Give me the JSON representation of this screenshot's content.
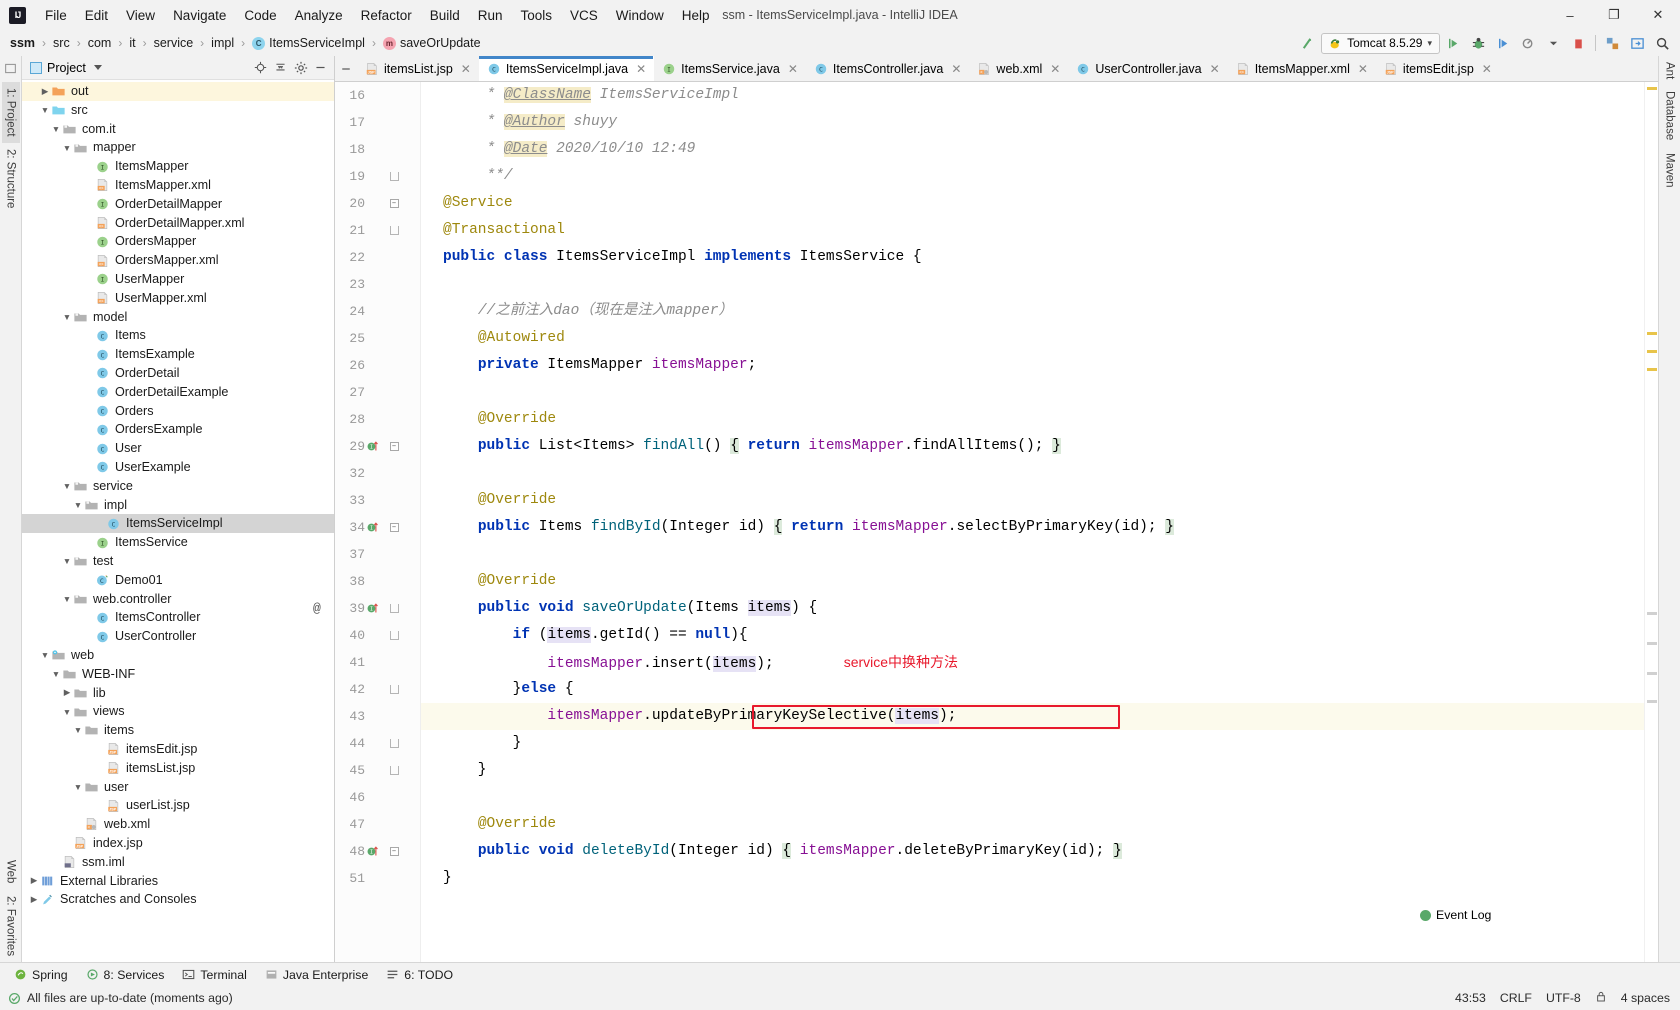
{
  "window": {
    "title": "ssm - ItemsServiceImpl.java - IntelliJ IDEA",
    "logo": "IJ",
    "minimize": "–",
    "maximize": "❐",
    "close": "✕"
  },
  "menu": [
    "File",
    "Edit",
    "View",
    "Navigate",
    "Code",
    "Analyze",
    "Refactor",
    "Build",
    "Run",
    "Tools",
    "VCS",
    "Window",
    "Help"
  ],
  "breadcrumb": {
    "items": [
      {
        "label": "ssm",
        "icon": "",
        "bold": true
      },
      {
        "label": "src",
        "icon": ""
      },
      {
        "label": "com",
        "icon": ""
      },
      {
        "label": "it",
        "icon": ""
      },
      {
        "label": "service",
        "icon": ""
      },
      {
        "label": "impl",
        "icon": ""
      },
      {
        "label": "ItemsServiceImpl",
        "icon": "class-icon"
      },
      {
        "label": "saveOrUpdate",
        "icon": "method-icon"
      }
    ],
    "separator": "›"
  },
  "toolbar": {
    "run_config": "Tomcat 8.5.29",
    "dropdown_caret": "▾",
    "buttons": [
      "build-icon",
      "run-icon",
      "debug-icon",
      "run-with-coverage-icon",
      "profile-icon",
      "stop-icon",
      "deploy-icon",
      "open-browser-icon",
      "search-everywhere-icon"
    ]
  },
  "left_strips": {
    "top": [
      "1: Project",
      "2: Structure"
    ],
    "bottom": [
      "2: Favorites",
      "Web"
    ]
  },
  "right_strips": [
    "Ant",
    "Database",
    "Maven"
  ],
  "project_panel": {
    "title": "Project",
    "tools": [
      "locate-icon",
      "collapse-all-icon",
      "settings-icon",
      "hide-icon"
    ],
    "tree": [
      {
        "depth": 1,
        "label": "out",
        "arrow": "right",
        "icon": "folder-orange",
        "state": "highlight"
      },
      {
        "depth": 1,
        "label": "src",
        "arrow": "down",
        "icon": "folder-blue"
      },
      {
        "depth": 2,
        "label": "com.it",
        "arrow": "down",
        "icon": "package"
      },
      {
        "depth": 3,
        "label": "mapper",
        "arrow": "down",
        "icon": "package"
      },
      {
        "depth": 5,
        "label": "ItemsMapper",
        "arrow": "none",
        "icon": "interface"
      },
      {
        "depth": 5,
        "label": "ItemsMapper.xml",
        "arrow": "none",
        "icon": "xml"
      },
      {
        "depth": 5,
        "label": "OrderDetailMapper",
        "arrow": "none",
        "icon": "interface"
      },
      {
        "depth": 5,
        "label": "OrderDetailMapper.xml",
        "arrow": "none",
        "icon": "xml"
      },
      {
        "depth": 5,
        "label": "OrdersMapper",
        "arrow": "none",
        "icon": "interface"
      },
      {
        "depth": 5,
        "label": "OrdersMapper.xml",
        "arrow": "none",
        "icon": "xml"
      },
      {
        "depth": 5,
        "label": "UserMapper",
        "arrow": "none",
        "icon": "interface"
      },
      {
        "depth": 5,
        "label": "UserMapper.xml",
        "arrow": "none",
        "icon": "xml"
      },
      {
        "depth": 3,
        "label": "model",
        "arrow": "down",
        "icon": "package"
      },
      {
        "depth": 5,
        "label": "Items",
        "arrow": "none",
        "icon": "class"
      },
      {
        "depth": 5,
        "label": "ItemsExample",
        "arrow": "none",
        "icon": "class"
      },
      {
        "depth": 5,
        "label": "OrderDetail",
        "arrow": "none",
        "icon": "class"
      },
      {
        "depth": 5,
        "label": "OrderDetailExample",
        "arrow": "none",
        "icon": "class"
      },
      {
        "depth": 5,
        "label": "Orders",
        "arrow": "none",
        "icon": "class"
      },
      {
        "depth": 5,
        "label": "OrdersExample",
        "arrow": "none",
        "icon": "class"
      },
      {
        "depth": 5,
        "label": "User",
        "arrow": "none",
        "icon": "class"
      },
      {
        "depth": 5,
        "label": "UserExample",
        "arrow": "none",
        "icon": "class"
      },
      {
        "depth": 3,
        "label": "service",
        "arrow": "down",
        "icon": "package"
      },
      {
        "depth": 4,
        "label": "impl",
        "arrow": "down",
        "icon": "package"
      },
      {
        "depth": 6,
        "label": "ItemsServiceImpl",
        "arrow": "none",
        "icon": "class",
        "state": "selected"
      },
      {
        "depth": 5,
        "label": "ItemsService",
        "arrow": "none",
        "icon": "interface"
      },
      {
        "depth": 3,
        "label": "test",
        "arrow": "down",
        "icon": "package"
      },
      {
        "depth": 5,
        "label": "Demo01",
        "arrow": "none",
        "icon": "class-test"
      },
      {
        "depth": 3,
        "label": "web.controller",
        "arrow": "down",
        "icon": "package"
      },
      {
        "depth": 5,
        "label": "ItemsController",
        "arrow": "none",
        "icon": "class"
      },
      {
        "depth": 5,
        "label": "UserController",
        "arrow": "none",
        "icon": "class"
      },
      {
        "depth": 1,
        "label": "web",
        "arrow": "down",
        "icon": "folder-web"
      },
      {
        "depth": 2,
        "label": "WEB-INF",
        "arrow": "down",
        "icon": "folder-gray"
      },
      {
        "depth": 3,
        "label": "lib",
        "arrow": "right",
        "icon": "folder-gray"
      },
      {
        "depth": 3,
        "label": "views",
        "arrow": "down",
        "icon": "folder-gray"
      },
      {
        "depth": 4,
        "label": "items",
        "arrow": "down",
        "icon": "folder-gray"
      },
      {
        "depth": 6,
        "label": "itemsEdit.jsp",
        "arrow": "none",
        "icon": "jsp"
      },
      {
        "depth": 6,
        "label": "itemsList.jsp",
        "arrow": "none",
        "icon": "jsp"
      },
      {
        "depth": 4,
        "label": "user",
        "arrow": "down",
        "icon": "folder-gray"
      },
      {
        "depth": 6,
        "label": "userList.jsp",
        "arrow": "none",
        "icon": "jsp"
      },
      {
        "depth": 4,
        "label": "web.xml",
        "arrow": "none",
        "icon": "xml-web"
      },
      {
        "depth": 3,
        "label": "index.jsp",
        "arrow": "none",
        "icon": "jsp"
      },
      {
        "depth": 2,
        "label": "ssm.iml",
        "arrow": "none",
        "icon": "iml"
      },
      {
        "depth": 0,
        "label": "External Libraries",
        "arrow": "right",
        "icon": "libraries"
      },
      {
        "depth": 0,
        "label": "Scratches and Consoles",
        "arrow": "right",
        "icon": "scratches"
      }
    ]
  },
  "editor_tabs": [
    {
      "label": "itemsList.jsp",
      "icon": "jsp",
      "active": false
    },
    {
      "label": "ItemsServiceImpl.java",
      "icon": "class",
      "active": true
    },
    {
      "label": "ItemsService.java",
      "icon": "interface",
      "active": false
    },
    {
      "label": "ItemsController.java",
      "icon": "class",
      "active": false
    },
    {
      "label": "web.xml",
      "icon": "xml-web",
      "active": false
    },
    {
      "label": "UserController.java",
      "icon": "class",
      "active": false
    },
    {
      "label": "ItemsMapper.xml",
      "icon": "xml",
      "active": false
    },
    {
      "label": "itemsEdit.jsp",
      "icon": "jsp",
      "active": false
    }
  ],
  "tab_close_glyph": "✕",
  "code": {
    "lines": [
      {
        "num": "16",
        "fold": "",
        "mark": "",
        "html": "     <span class=\"doc\">* </span><span class=\"doctag\">@ClassName</span><span class=\"doc\"> ItemsServiceImpl</span>"
      },
      {
        "num": "17",
        "fold": "",
        "mark": "",
        "html": "     <span class=\"doc\">* </span><span class=\"doctag\">@Author</span><span class=\"doc\"> shuyy</span>"
      },
      {
        "num": "18",
        "fold": "",
        "mark": "",
        "html": "     <span class=\"doc\">* </span><span class=\"doctag\">@Date</span><span class=\"doc\"> 2020/10/10 12:49</span>"
      },
      {
        "num": "19",
        "fold": "arc",
        "mark": "",
        "html": "     <span class=\"doc\">**/</span>"
      },
      {
        "num": "20",
        "fold": "box",
        "mark": "",
        "html": "<span class=\"anno\">@Service</span>"
      },
      {
        "num": "21",
        "fold": "arc",
        "mark": "",
        "html": "<span class=\"anno\">@Transactional</span>"
      },
      {
        "num": "22",
        "fold": "",
        "mark": "",
        "html": "<span class=\"kw\">public</span> <span class=\"kw\">class</span> ItemsServiceImpl <span class=\"kw\">implements</span> ItemsService {"
      },
      {
        "num": "23",
        "fold": "",
        "mark": "",
        "html": ""
      },
      {
        "num": "24",
        "fold": "",
        "mark": "",
        "html": "    <span class=\"cmt\">//之前注入dao（现在是注入mapper）</span>"
      },
      {
        "num": "25",
        "fold": "",
        "mark": "",
        "html": "    <span class=\"anno\">@Autowired</span>"
      },
      {
        "num": "26",
        "fold": "",
        "mark": "",
        "html": "    <span class=\"kw\">private</span> ItemsMapper <span class=\"fld\">itemsMapper</span>;"
      },
      {
        "num": "27",
        "fold": "",
        "mark": "",
        "html": ""
      },
      {
        "num": "28",
        "fold": "",
        "mark": "",
        "html": "    <span class=\"anno\">@Override</span>"
      },
      {
        "num": "29",
        "fold": "box",
        "mark": "impl",
        "html": "    <span class=\"kw\">public</span> List&lt;Items&gt; <span class=\"mth\">findAll</span>() <span class=\"hl-brace\">{</span> <span class=\"kw\">return</span> <span class=\"fld\">itemsMapper</span>.findAllItems(); <span class=\"hl-brace\">}</span>"
      },
      {
        "num": "32",
        "fold": "",
        "mark": "",
        "html": ""
      },
      {
        "num": "33",
        "fold": "",
        "mark": "",
        "html": "    <span class=\"anno\">@Override</span>"
      },
      {
        "num": "34",
        "fold": "box",
        "mark": "impl",
        "html": "    <span class=\"kw\">public</span> Items <span class=\"mth\">findById</span>(Integer id) <span class=\"hl-brace\">{</span> <span class=\"kw\">return</span> <span class=\"fld\">itemsMapper</span>.selectByPrimaryKey(id); <span class=\"hl-brace\">}</span>"
      },
      {
        "num": "37",
        "fold": "",
        "mark": "",
        "html": ""
      },
      {
        "num": "38",
        "fold": "",
        "mark": "",
        "html": "    <span class=\"anno\">@Override</span>"
      },
      {
        "num": "39",
        "fold": "arc",
        "mark": "impl-at",
        "html": "    <span class=\"kw\">public</span> <span class=\"kw\">void</span> <span class=\"mth\">saveOrUpdate</span>(Items <span class=\"hl-occ\">items</span>) {"
      },
      {
        "num": "40",
        "fold": "arc",
        "mark": "",
        "html": "        <span class=\"kw\">if</span> (<span class=\"hl-occ\">items</span>.getId() == <span class=\"kw\">null</span>){"
      },
      {
        "num": "41",
        "fold": "",
        "mark": "",
        "html": "            <span class=\"fld\">itemsMapper</span>.insert(<span class=\"hl-occ\">items</span>);",
        "note": "service中换种方法"
      },
      {
        "num": "42",
        "fold": "arc",
        "mark": "",
        "html": "        }<span class=\"kw\">else</span> {"
      },
      {
        "num": "43",
        "fold": "",
        "mark": "",
        "html": "            <span class=\"fld\">itemsMapper</span>.updateByPrimaryKeySelective(<span class=\"hl-occ\">items</span>);",
        "current": true,
        "boxed": true
      },
      {
        "num": "44",
        "fold": "arc",
        "mark": "",
        "html": "        }"
      },
      {
        "num": "45",
        "fold": "arc",
        "mark": "",
        "html": "    }"
      },
      {
        "num": "46",
        "fold": "",
        "mark": "",
        "html": ""
      },
      {
        "num": "47",
        "fold": "",
        "mark": "",
        "html": "    <span class=\"anno\">@Override</span>"
      },
      {
        "num": "48",
        "fold": "box",
        "mark": "impl",
        "html": "    <span class=\"kw\">public</span> <span class=\"kw\">void</span> <span class=\"mth\">deleteById</span>(Integer id) <span class=\"hl-brace\">{</span> <span class=\"fld\">itemsMapper</span>.deleteByPrimaryKey(id); <span class=\"hl-brace\">}</span>"
      },
      {
        "num": "51",
        "fold": "",
        "mark": "",
        "html": "}"
      }
    ],
    "annotation": "service中换种方法",
    "annotation_color": "#e8192c"
  },
  "bottom_tools": [
    {
      "label": "Spring",
      "icon": "spring-icon"
    },
    {
      "label": "8: Services",
      "icon": "services-icon"
    },
    {
      "label": "Terminal",
      "icon": "terminal-icon"
    },
    {
      "label": "Java Enterprise",
      "icon": "javaee-icon"
    },
    {
      "label": "6: TODO",
      "icon": "todo-icon"
    }
  ],
  "status": {
    "message": "All files are up-to-date (moments ago)",
    "position": "43:53",
    "line_separator": "CRLF",
    "encoding": "UTF-8",
    "lock": "lock-icon",
    "indent": "4 spaces",
    "event_log": "Event Log"
  }
}
